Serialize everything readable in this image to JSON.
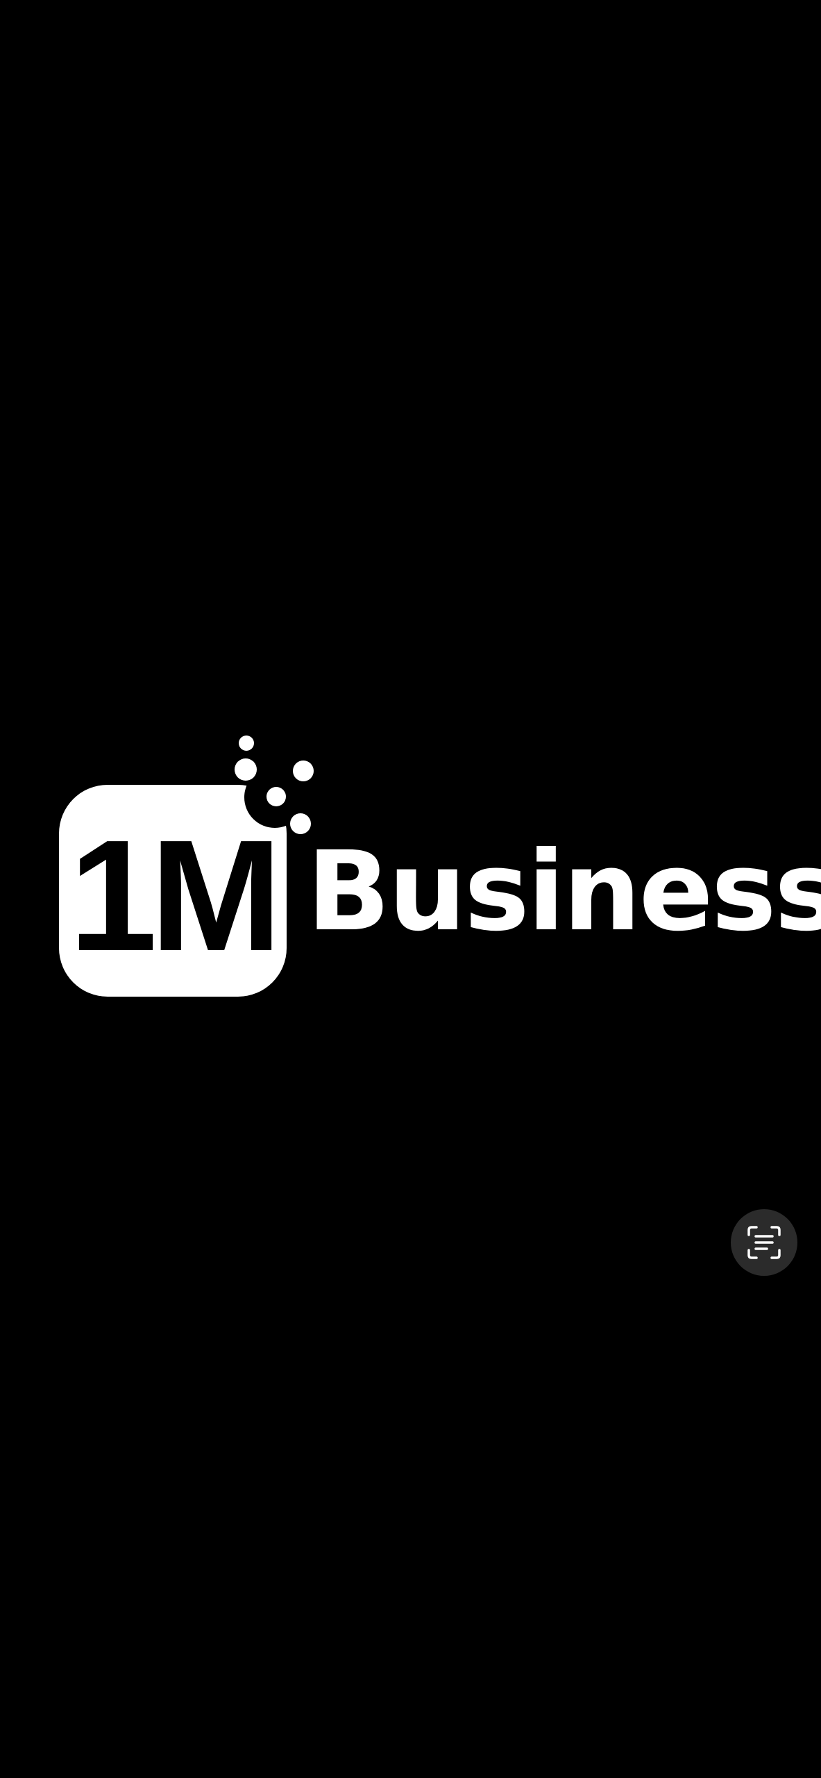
{
  "splash": {
    "background_color": "#000000",
    "logo": {
      "mark_text": "1M",
      "wordmark": "Business",
      "foreground_color": "#ffffff",
      "mark_text_color": "#000000"
    }
  },
  "floating_action": {
    "icon": "text-scan-icon",
    "background_color": "#2b2b2b",
    "icon_color": "#ffffff"
  }
}
